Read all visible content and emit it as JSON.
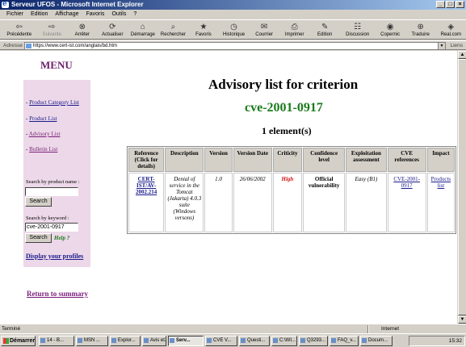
{
  "window": {
    "title": "Serveur UFOS - Microsoft Internet Explorer"
  },
  "menubar": [
    "Fichier",
    "Edition",
    "Affichage",
    "Favoris",
    "Outils",
    "?"
  ],
  "toolbar": [
    {
      "label": "Précédente",
      "icon": "back-arrow-icon"
    },
    {
      "label": "Suivante",
      "icon": "forward-arrow-icon"
    },
    {
      "label": "Arrêter",
      "icon": "stop-icon"
    },
    {
      "label": "Actualiser",
      "icon": "refresh-icon"
    },
    {
      "label": "Démarrage",
      "icon": "home-icon"
    },
    {
      "label": "Rechercher",
      "icon": "search-icon"
    },
    {
      "label": "Favoris",
      "icon": "favorites-icon"
    },
    {
      "label": "Historique",
      "icon": "history-icon"
    },
    {
      "label": "Courrier",
      "icon": "mail-icon"
    },
    {
      "label": "Imprimer",
      "icon": "print-icon"
    },
    {
      "label": "Edition",
      "icon": "edit-icon"
    },
    {
      "label": "Discussion",
      "icon": "discussion-icon"
    },
    {
      "label": "Copernic",
      "icon": "copernic-icon"
    },
    {
      "label": "Traduire",
      "icon": "translate-icon"
    },
    {
      "label": "Real.com",
      "icon": "real-icon"
    }
  ],
  "address": {
    "label": "Adresse",
    "url": "https://www.cert-ist.com/anglais/bd.htm",
    "links_label": "Liens"
  },
  "sidebar": {
    "menu_title": "MENU",
    "links": [
      {
        "label": "Product Category List"
      },
      {
        "label": "Product List"
      },
      {
        "label": "Advisory List"
      },
      {
        "label": "Bulletin List"
      }
    ],
    "search_name_label": "Search by product name :",
    "search_name_value": "",
    "search_button": "Search",
    "search_keyword_label": "Search by keyword :",
    "search_keyword_value": "cve-2001-0917",
    "help_label": "Help ?",
    "profiles_label": "Display your profiles",
    "return_label": "Return to summary"
  },
  "main": {
    "title": "Advisory list for criterion",
    "criterion": "cve-2001-0917",
    "count": "1 element(s)",
    "columns": [
      "Reference (Click for details)",
      "Description",
      "Version",
      "Version Date",
      "Criticity",
      "Confidence level",
      "Exploitation assessment",
      "CVE references",
      "Impact"
    ],
    "row": {
      "reference": "CERT-IST/AV-2002.214",
      "description": "Denial of service in the Tomcat (Jakarta) 4.0.3 suite (Windows versons)",
      "version": "1.0",
      "date": "26/06/2002",
      "criticity": "High",
      "confidence": "Official vulnerability",
      "exploitation": "Easy (B1)",
      "cve": "CVE-2001-0917",
      "impact": "Products list"
    }
  },
  "status": {
    "text": "Terminé",
    "zone": "Internet"
  },
  "taskbar": {
    "start": "Démarrer",
    "tasks": [
      "14 - B...",
      "MSN ...",
      "Explor...",
      "Avis et...",
      "Serv...",
      "CVE V...",
      "Questi...",
      "C:\\WI...",
      "Q3293...",
      "FAQ_v...",
      "Docum..."
    ],
    "clock": "15:32"
  }
}
